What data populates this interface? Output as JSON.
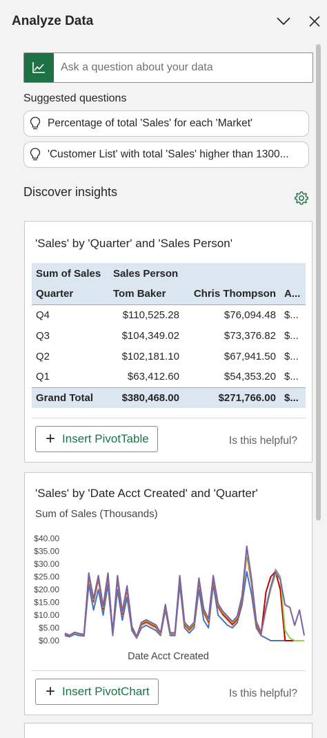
{
  "pane": {
    "title": "Analyze Data",
    "collapse_icon": "chevron-down-icon",
    "close_icon": "close-icon"
  },
  "ask": {
    "placeholder": "Ask a question about your data",
    "icon": "chart-line-icon",
    "value": ""
  },
  "suggested": {
    "label": "Suggested questions",
    "items": [
      {
        "icon": "lightbulb-icon",
        "text": "Percentage of total 'Sales' for each 'Market'"
      },
      {
        "icon": "lightbulb-icon",
        "text": "'Customer List' with total 'Sales' higher than 1300..."
      }
    ]
  },
  "discover": {
    "title": "Discover insights",
    "settings_icon": "gear-icon"
  },
  "insight1": {
    "title": "'Sales' by 'Quarter' and 'Sales Person'",
    "table": {
      "header1": [
        "Sum of Sales",
        "Sales Person",
        "",
        ""
      ],
      "header2": [
        "Quarter",
        "Tom Baker",
        "Chris Thompson",
        "A..."
      ],
      "rows": [
        [
          "Q4",
          "$110,525.28",
          "$76,094.48",
          "$..."
        ],
        [
          "Q3",
          "$104,349.02",
          "$73,376.82",
          "$..."
        ],
        [
          "Q2",
          "$102,181.10",
          "$67,941.50",
          "$..."
        ],
        [
          "Q1",
          "$63,412.60",
          "$54,353.20",
          "$..."
        ]
      ],
      "total": [
        "Grand Total",
        "$380,468.00",
        "$271,766.00",
        "$..."
      ]
    },
    "insert_label": "Insert PivotTable",
    "helpful_label": "Is this helpful?"
  },
  "insight2": {
    "title": "'Sales' by 'Date Acct Created' and 'Quarter'",
    "insert_label": "Insert PivotChart",
    "helpful_label": "Is this helpful?"
  },
  "chart_data": {
    "type": "line",
    "title": "'Sales' by 'Date Acct Created' and 'Quarter'",
    "subtitle": "Sum of Sales (Thousands)",
    "xlabel": "Date Acct Created",
    "ylabel": "",
    "ylim": [
      0,
      40
    ],
    "yticks": [
      "$0.00",
      "$5.00",
      "$10.00",
      "$15.00",
      "$20.00",
      "$25.00",
      "$30.00",
      "$35.00",
      "$40.00"
    ],
    "grid": false,
    "legend": "none",
    "series": [
      {
        "color": "#4472c4",
        "values": [
          2,
          1.5,
          2.5,
          2,
          1.8,
          22,
          12,
          20,
          10,
          22,
          2,
          20,
          8,
          17,
          4,
          1,
          5,
          6,
          5,
          4,
          2,
          12,
          2,
          2,
          22,
          5,
          3,
          5,
          20,
          8,
          5,
          22,
          10,
          8,
          6,
          5,
          7,
          14,
          27,
          18,
          5,
          2,
          1,
          0,
          0,
          0,
          0,
          0,
          0,
          0,
          0
        ]
      },
      {
        "color": "#ed7d31",
        "values": [
          2.5,
          1.8,
          3,
          2.5,
          2.2,
          25,
          15,
          24,
          12,
          25,
          2.5,
          24,
          10,
          20,
          5,
          1.2,
          6,
          7,
          6,
          5,
          2.5,
          13,
          2.5,
          2.5,
          24,
          6,
          4,
          6,
          23,
          11,
          7,
          24,
          13,
          10,
          8,
          6,
          8,
          16,
          34,
          22,
          6,
          2.5,
          12,
          20,
          27,
          24,
          0,
          0,
          0,
          0,
          0
        ]
      },
      {
        "color": "#a5a5a5",
        "values": [
          2.8,
          2,
          3.2,
          2.7,
          2.4,
          26,
          16,
          25,
          13,
          26,
          2.8,
          25,
          11,
          21,
          5.5,
          1.5,
          7,
          8,
          7,
          6,
          3,
          14,
          3,
          3,
          25,
          7,
          5,
          7,
          24,
          12,
          8,
          25,
          14,
          11,
          9,
          7,
          9,
          17,
          35,
          23,
          7,
          3,
          13,
          21,
          28,
          25,
          0,
          0,
          0,
          0,
          0
        ]
      },
      {
        "color": "#c00000",
        "values": [
          2.6,
          1.9,
          3.1,
          2.6,
          2.3,
          25.5,
          15.5,
          24.5,
          12.5,
          25.5,
          2.6,
          24.5,
          10.5,
          20.5,
          5.2,
          1.3,
          6.5,
          7.5,
          6.5,
          5.5,
          2.7,
          13.5,
          2.7,
          2.7,
          24.5,
          6.5,
          4.5,
          6.5,
          23.5,
          11.5,
          7.5,
          24.5,
          13.5,
          10.5,
          8.5,
          6.5,
          8.5,
          16.5,
          34.5,
          22.5,
          6.5,
          2.7,
          19,
          25,
          27,
          20,
          0,
          0,
          0,
          0,
          0
        ]
      },
      {
        "color": "#92d050",
        "values": [
          2.7,
          2,
          3.1,
          2.6,
          2.4,
          26,
          16,
          25,
          13,
          26,
          2.7,
          25,
          11,
          21,
          5.4,
          1.4,
          6.8,
          7.8,
          6.8,
          5.8,
          2.8,
          13.8,
          2.8,
          2.8,
          25,
          6.8,
          4.8,
          6.8,
          24,
          12,
          8,
          25,
          14,
          11,
          9,
          7,
          9,
          17,
          35,
          23,
          7,
          3,
          12,
          20,
          26,
          25,
          4,
          1,
          0,
          0,
          0
        ]
      },
      {
        "color": "#7f5fa8",
        "values": [
          2.9,
          2.1,
          3.3,
          2.8,
          2.5,
          26.5,
          16.5,
          25.5,
          13.5,
          26.5,
          2.9,
          25.5,
          11.5,
          21.5,
          5.6,
          1.6,
          7.2,
          8.2,
          7.2,
          6.2,
          3.1,
          14.2,
          3.1,
          3.1,
          25.5,
          7.2,
          5.2,
          7.2,
          24.5,
          12.5,
          8.5,
          25.5,
          14.5,
          11.5,
          9.5,
          7.5,
          9.5,
          17.5,
          37,
          24,
          7.5,
          3.2,
          13,
          21,
          27,
          24,
          14,
          13,
          6,
          12,
          2
        ]
      }
    ]
  }
}
